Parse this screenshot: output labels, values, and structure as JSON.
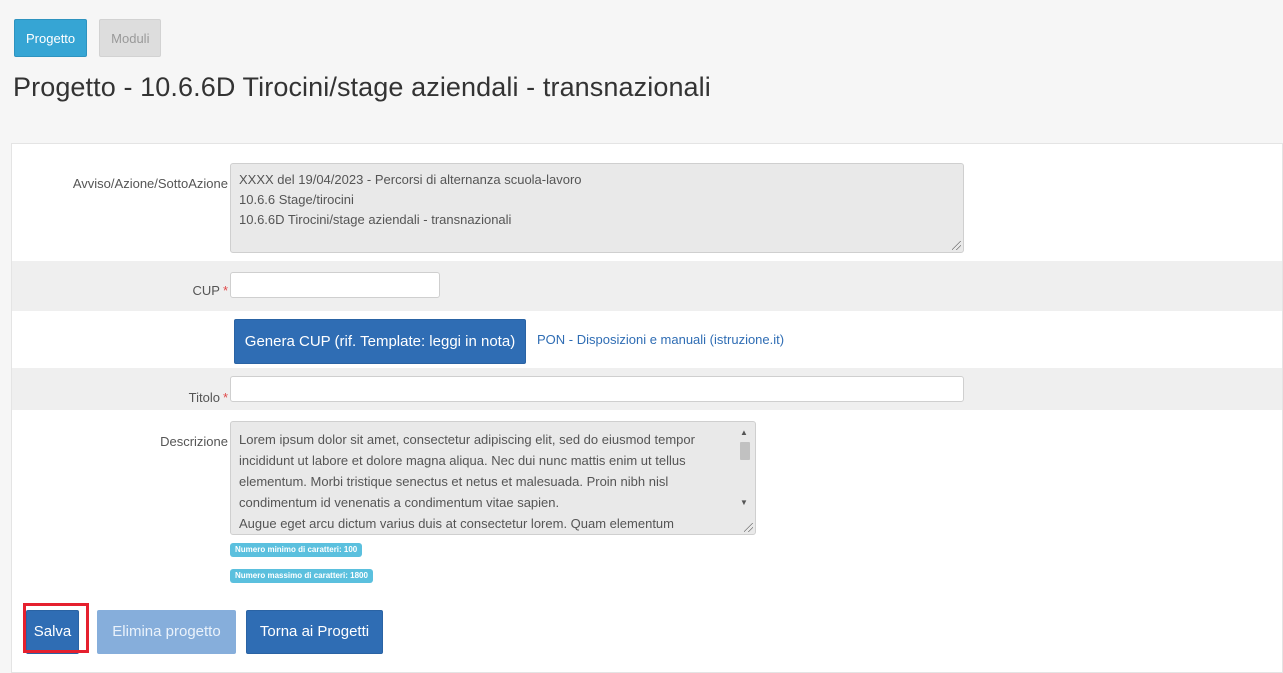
{
  "tabs": [
    {
      "label": "Progetto"
    },
    {
      "label": "Moduli"
    }
  ],
  "page": {
    "title": "Progetto - 10.6.6D Tirocini/stage aziendali - transnazionali"
  },
  "form": {
    "avviso": {
      "label": "Avviso/Azione/SottoAzione",
      "lines": [
        "XXXX del 19/04/2023 - Percorsi di alternanza scuola-lavoro",
        "10.6.6  Stage/tirocini",
        "10.6.6D Tirocini/stage aziendali - transnazionali"
      ]
    },
    "cup": {
      "label": "CUP",
      "required_mark": "*",
      "value": ""
    },
    "genera_cup_button": "Genera CUP (rif. Template: leggi in nota)",
    "pon_link": "PON - Disposizioni e manuali (istruzione.it)",
    "titolo": {
      "label": "Titolo",
      "required_mark": "*",
      "value": ""
    },
    "descrizione": {
      "label": "Descrizione",
      "lines": [
        "Lorem ipsum dolor sit amet, consectetur adipiscing elit, sed do eiusmod tempor",
        "incididunt ut labore et dolore magna aliqua. Nec dui nunc mattis enim ut tellus",
        "elementum. Morbi tristique senectus et netus et malesuada. Proin nibh nisl",
        "condimentum id venenatis a condimentum vitae sapien.",
        "Augue eget arcu dictum varius duis at consectetur lorem. Quam elementum"
      ]
    },
    "badge_min": "Numero minimo di caratteri: 100",
    "badge_max": "Numero massimo di caratteri: 1800"
  },
  "actions": {
    "save": "Salva",
    "delete": "Elimina progetto",
    "back": "Torna ai Progetti"
  },
  "colors": {
    "accent": "#36a5d4",
    "primary_button": "#2f6db4",
    "disabled_button": "#86aedb",
    "badge": "#5bc0de",
    "required": "#e04848",
    "highlight_border": "#e5202e"
  },
  "icons": {
    "scroll_up": "▲",
    "scroll_down": "▼"
  }
}
